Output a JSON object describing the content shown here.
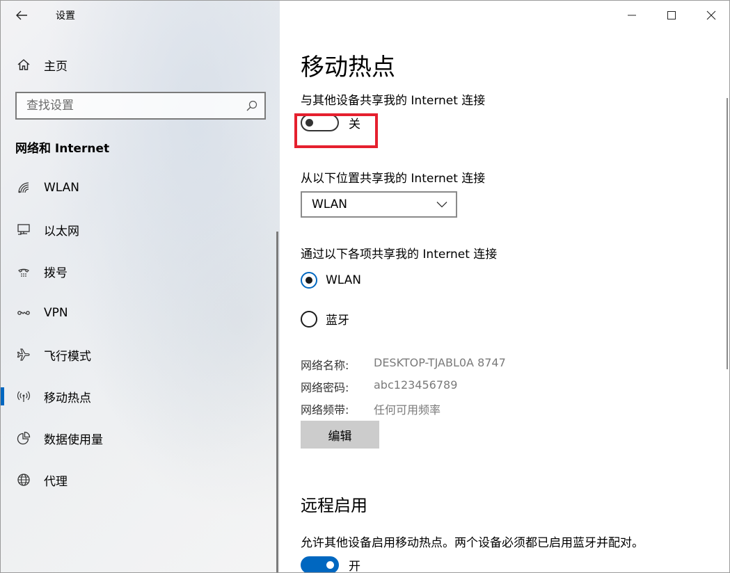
{
  "window": {
    "title": "设置",
    "controls": {
      "minimize": "minimize",
      "maximize": "maximize",
      "close": "close"
    }
  },
  "sidebar": {
    "home_label": "主页",
    "search_placeholder": "查找设置",
    "section_title": "网络和 Internet",
    "items": [
      {
        "label": "WLAN",
        "icon": "wifi-icon"
      },
      {
        "label": "以太网",
        "icon": "ethernet-icon"
      },
      {
        "label": "拨号",
        "icon": "dialup-icon"
      },
      {
        "label": "VPN",
        "icon": "vpn-icon"
      },
      {
        "label": "飞行模式",
        "icon": "airplane-icon"
      },
      {
        "label": "移动热点",
        "icon": "hotspot-icon",
        "active": true
      },
      {
        "label": "数据使用量",
        "icon": "data-usage-icon"
      },
      {
        "label": "代理",
        "icon": "globe-icon"
      }
    ]
  },
  "main": {
    "page_title": "移动热点",
    "share_label": "与其他设备共享我的 Internet 连接",
    "share_toggle": {
      "state_text": "关",
      "on": false
    },
    "share_from_label": "从以下位置共享我的 Internet 连接",
    "share_from_value": "WLAN",
    "share_via_label": "通过以下各项共享我的 Internet 连接",
    "share_via_options": [
      {
        "label": "WLAN",
        "checked": true
      },
      {
        "label": "蓝牙",
        "checked": false
      }
    ],
    "network_info": [
      {
        "key": "网络名称:",
        "value": "DESKTOP-TJABL0A 8747"
      },
      {
        "key": "网络密码:",
        "value": "abc123456789"
      },
      {
        "key": "网络频带:",
        "value": "任何可用频率"
      }
    ],
    "edit_button": "编辑",
    "remote_title": "远程启用",
    "remote_desc": "允许其他设备启用移动热点。两个设备必须都已启用蓝牙并配对。",
    "remote_toggle": {
      "state_text": "开",
      "on": true
    }
  },
  "colors": {
    "accent": "#0067c0",
    "highlight": "#e5202e"
  }
}
